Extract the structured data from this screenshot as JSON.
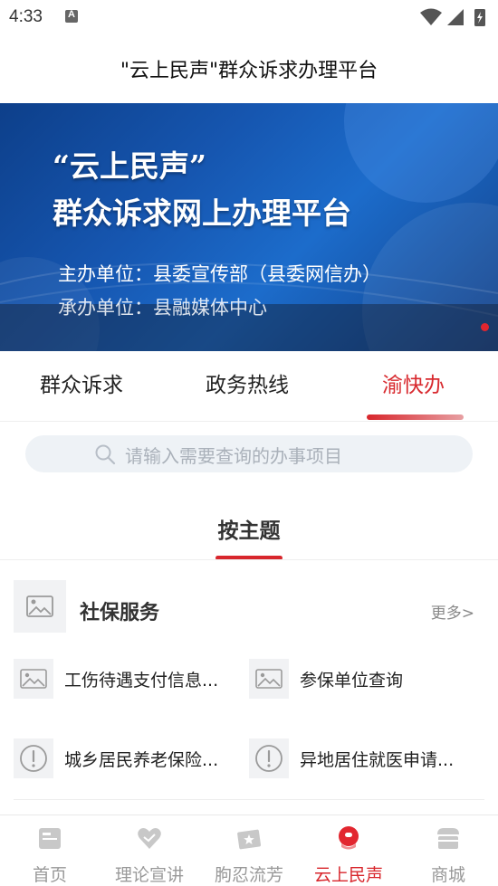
{
  "status_bar": {
    "time": "4:33"
  },
  "header": {
    "title": "\"云上民声\"群众诉求办理平台"
  },
  "banner": {
    "heading_line1": "“云上民声”",
    "heading_line2": "群众诉求网上办理平台",
    "host": "主办单位：县委宣传部（县委网信办）",
    "organizer": "承办单位：县融媒体中心"
  },
  "tabs": [
    {
      "label": "群众诉求"
    },
    {
      "label": "政务热线"
    },
    {
      "label": "渝快办",
      "active": true
    }
  ],
  "search": {
    "placeholder": "请输入需要查询的办事项目"
  },
  "section": {
    "label": "按主题"
  },
  "category": {
    "title": "社保服务",
    "more": "更多>",
    "items": [
      {
        "label": "工伤待遇支付信息...",
        "icon": "image-icon"
      },
      {
        "label": "参保单位查询",
        "icon": "image-icon"
      },
      {
        "label": "城乡居民养老保险...",
        "icon": "info-icon"
      },
      {
        "label": "异地居住就医申请...",
        "icon": "info-icon"
      }
    ]
  },
  "bottom_nav": [
    {
      "label": "首页",
      "icon": "home-icon"
    },
    {
      "label": "理论宣讲",
      "icon": "heart-hands-icon"
    },
    {
      "label": "朐忍流芳",
      "icon": "ticket-star-icon"
    },
    {
      "label": "云上民声",
      "icon": "voice-icon",
      "active": true
    },
    {
      "label": "商城",
      "icon": "shop-icon"
    }
  ],
  "colors": {
    "accent": "#d8262c",
    "banner_blue": "#1656b0",
    "search_bg": "#eef2f6"
  }
}
